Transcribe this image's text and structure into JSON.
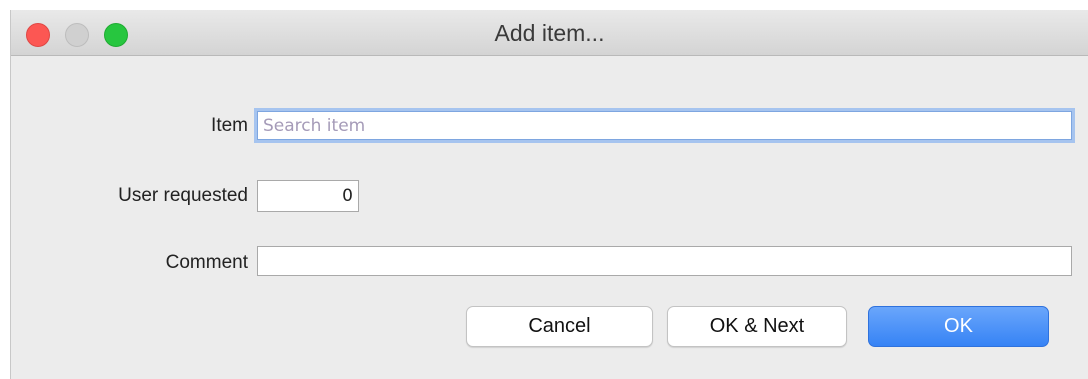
{
  "window": {
    "title": "Add item..."
  },
  "form": {
    "item_label": "Item",
    "item_placeholder": "Search item",
    "item_value": "",
    "user_requested_label": "User requested",
    "user_requested_value": "0",
    "comment_label": "Comment",
    "comment_value": ""
  },
  "buttons": {
    "cancel": "Cancel",
    "ok_next": "OK & Next",
    "ok": "OK"
  },
  "colors": {
    "close": "#fc5753",
    "minimize": "#d0d0d0",
    "maximize": "#27c63f",
    "primary_button": "#3683f5",
    "focus_ring": "#a6c4ef"
  }
}
